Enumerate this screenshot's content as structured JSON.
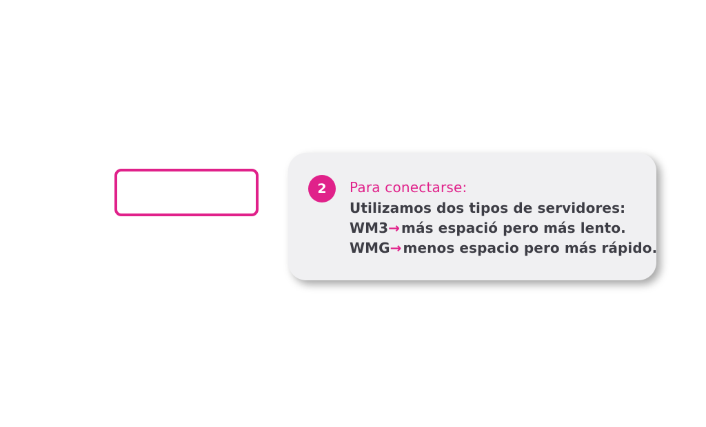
{
  "callout": {
    "step_number": "2",
    "title": "Para conectarse:",
    "intro": "Utilizamos dos tipos de servidores:",
    "servers": [
      {
        "name": "WM3",
        "arrow": "→",
        "description": "más espació pero más lento."
      },
      {
        "name": "WMG",
        "arrow": "→",
        "description": "menos espacio pero más rápido."
      }
    ]
  },
  "colors": {
    "accent": "#e0218a",
    "callout_background": "#f0f0f2",
    "text": "#3d3d45"
  }
}
